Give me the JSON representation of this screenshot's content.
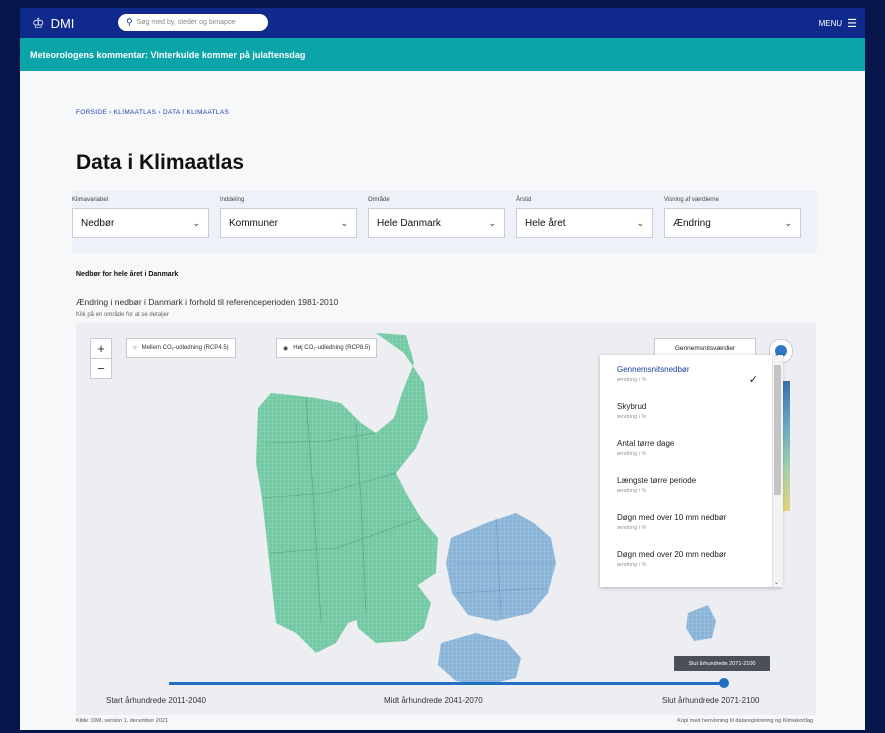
{
  "header": {
    "logo_text": "DMI",
    "search_placeholder": "Søg med by, steder og bimapoe",
    "menu_label": "MENU"
  },
  "banner": {
    "text": "Meteorologens kommentar: Vinterkulde kommer på julaftensdag"
  },
  "breadcrumb": "FORSIDE  ›  KLIMAATLAS  ›  DATA I KLIMAATLAS",
  "page_title": "Data i Klimaatlas",
  "filters": [
    {
      "label": "Klimavariabel",
      "value": "Nedbør"
    },
    {
      "label": "Inddeling",
      "value": "Kommuner"
    },
    {
      "label": "Område",
      "value": "Hele Danmark"
    },
    {
      "label": "Årstid",
      "value": "Hele året"
    },
    {
      "label": "Visning af værdierne",
      "value": "Ændring"
    }
  ],
  "section_title": "Nedbør for hele året i Danmark",
  "section_subtitle": "Ændring i nedbør i Danmark i forhold til referenceperioden 1981-2010",
  "section_hint": "Klik på en område for at se detaljer",
  "map": {
    "zoom_in": "+",
    "zoom_out": "−",
    "scenario_medium": "Mellem CO₂-udledning (RCP4.5)",
    "scenario_high": "Høj CO₂-udledning (RCP8.5)",
    "average_button": "Gennemsnitsværdier",
    "colors": {
      "land_green": "#72c9a3",
      "land_blue": "#89b4d8",
      "accent": "#1f70c1"
    }
  },
  "dropdown": {
    "items": [
      {
        "label": "Gennemsnitsnedbør",
        "sub": "ændring i %",
        "selected": true
      },
      {
        "label": "Skybrud",
        "sub": "ændring i %",
        "selected": false
      },
      {
        "label": "Antal tørre dage",
        "sub": "ændring i %",
        "selected": false
      },
      {
        "label": "Længste tørre periode",
        "sub": "ændring i %",
        "selected": false
      },
      {
        "label": "Døgn med over 10 mm nedbør",
        "sub": "ændring i %",
        "selected": false
      },
      {
        "label": "Døgn med over 20 mm nedbør",
        "sub": "ændring i %",
        "selected": false
      }
    ],
    "check_mark": "✓"
  },
  "timeline": {
    "start": "Start århundrede 2011-2040",
    "mid": "Midt århundrede 2041-2070",
    "end": "Slut århundrede 2071-2100",
    "tooltip": "Slut århundrede 2071-2100",
    "selected_fraction": 1.0
  },
  "footer": {
    "left": "Kilde: DMI, version 1, december 2021",
    "right": "Kopi med henvisning til dataregistrering og Klimakortlag"
  }
}
